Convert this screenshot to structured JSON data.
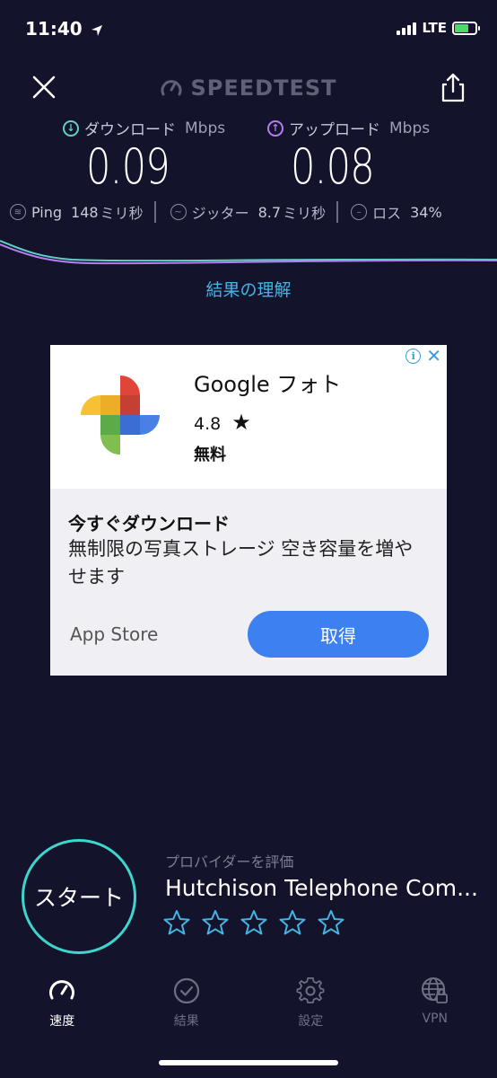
{
  "status": {
    "time": "11:40",
    "network": "LTE"
  },
  "header": {
    "logo": "SPEEDTEST"
  },
  "download": {
    "label": "ダウンロード",
    "unit": "Mbps",
    "value": "0.09"
  },
  "upload": {
    "label": "アップロード",
    "unit": "Mbps",
    "value": "0.08"
  },
  "stats": {
    "ping_label": "Ping",
    "ping_value": "148",
    "ping_unit": "ミリ秒",
    "jitter_label": "ジッター",
    "jitter_value": "8.7",
    "jitter_unit": "ミリ秒",
    "loss_label": "ロス",
    "loss_value": "34%"
  },
  "understand_link": "結果の理解",
  "ad": {
    "title": "Google フォト",
    "rating": "4.8",
    "price": "無料",
    "headline": "今すぐダウンロード",
    "body": "無制限の写真ストレージ 空き容量を増やせます",
    "store": "App Store",
    "cta": "取得",
    "info_icon": "i"
  },
  "start_button": "スタート",
  "provider": {
    "label": "プロバイダーを評価",
    "name": "Hutchison Telephone Com..."
  },
  "tabs": [
    {
      "label": "速度",
      "icon": "speedometer-icon",
      "active": true
    },
    {
      "label": "結果",
      "icon": "check-circle-icon",
      "active": false
    },
    {
      "label": "設定",
      "icon": "gear-icon",
      "active": false
    },
    {
      "label": "VPN",
      "icon": "globe-lock-icon",
      "active": false
    }
  ],
  "colors": {
    "background": "#13132b",
    "accent_teal": "#3ed6cc",
    "download_color": "#5ed2c8",
    "upload_color": "#b77cf0",
    "link_blue": "#45b4e4",
    "ad_button": "#3d80f0"
  }
}
